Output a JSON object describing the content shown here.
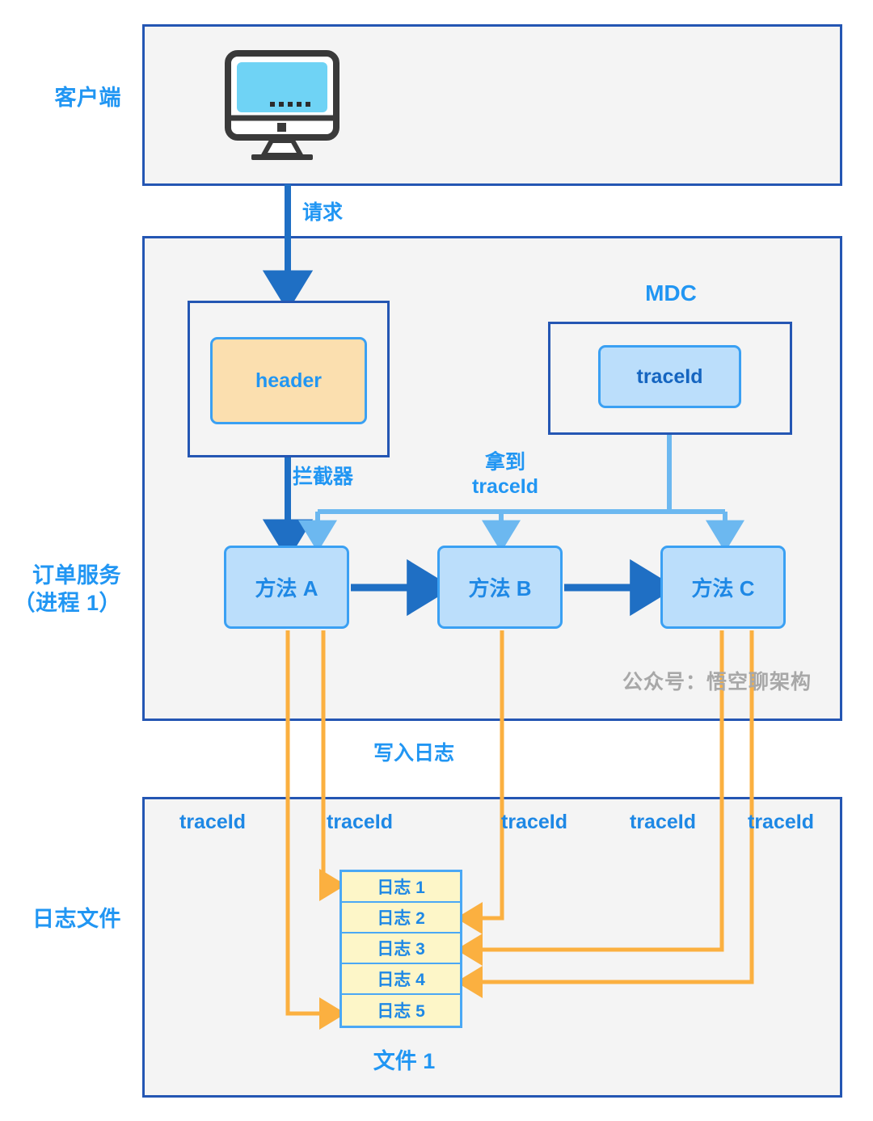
{
  "colors": {
    "panel_border": "#2456b3",
    "panel_fill": "#f4f4f4",
    "accent_blue": "#2196f3",
    "dark_blue_arrow": "#1565c0",
    "light_blue_arrow": "#6cb8f0",
    "orange_arrow": "#fbb040",
    "node_fill_blue": "#bbdefb",
    "node_fill_orange": "#fbdfaf",
    "log_fill": "#fdf6c8",
    "watermark_gray": "#a8a8a8"
  },
  "row_labels": {
    "client": "客户端",
    "order_service": "订单服务\n（进程 1）",
    "log_file": "日志文件"
  },
  "client_section": {
    "icon": "desktop-monitor-icon",
    "screen_dots": "•••••"
  },
  "flow_labels": {
    "request": "请求",
    "interceptor": "拦截器",
    "get_traceid": "拿到\ntraceId",
    "write_log": "写入日志",
    "file_name": "文件 1"
  },
  "service_section": {
    "header_box_label": "header",
    "mdc_title": "MDC",
    "mdc_traceid_label": "traceId",
    "methods": [
      {
        "label": "方法 A"
      },
      {
        "label": "方法 B"
      },
      {
        "label": "方法 C"
      }
    ]
  },
  "watermark": "公众号：悟空聊架构",
  "log_section": {
    "trace_columns": [
      "traceId",
      "traceId",
      "traceId",
      "traceId",
      "traceId"
    ],
    "logs": [
      {
        "label": "日志 1"
      },
      {
        "label": "日志 2"
      },
      {
        "label": "日志 3"
      },
      {
        "label": "日志 4"
      },
      {
        "label": "日志 5"
      }
    ]
  }
}
